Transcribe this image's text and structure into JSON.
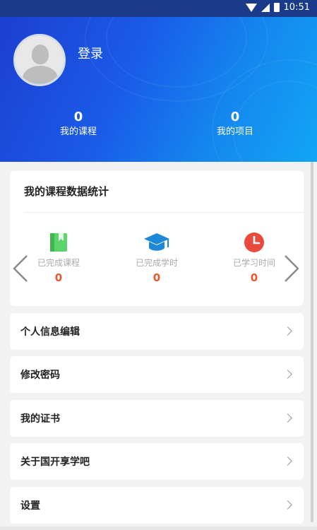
{
  "status_bar": {
    "time": "10:51",
    "icons": [
      "wifi-icon",
      "signal-icon",
      "battery-icon"
    ]
  },
  "profile": {
    "login_label": "登录",
    "avatar_icon": "default-avatar-icon"
  },
  "top_stats": [
    {
      "value": "0",
      "label": "我的课程"
    },
    {
      "value": "0",
      "label": "我的项目"
    }
  ],
  "stats_card": {
    "title": "我的课程数据统计",
    "items": [
      {
        "icon": "book-icon",
        "label": "已完成课程",
        "value": "0"
      },
      {
        "icon": "graduation-cap-icon",
        "label": "已完成学时",
        "value": "0"
      },
      {
        "icon": "clock-icon",
        "label": "已学习时间",
        "value": "0"
      }
    ]
  },
  "menu": [
    {
      "label": "个人信息编辑"
    },
    {
      "label": "修改密码"
    },
    {
      "label": "我的证书"
    },
    {
      "label": "关于国开享学吧"
    },
    {
      "label": "设置"
    }
  ],
  "colors": {
    "accent_blue": "#1a5be8",
    "value_orange": "#e8562e",
    "book_green": "#4cc85a",
    "clock_red": "#e84a3c",
    "cap_blue": "#1e88d8"
  }
}
